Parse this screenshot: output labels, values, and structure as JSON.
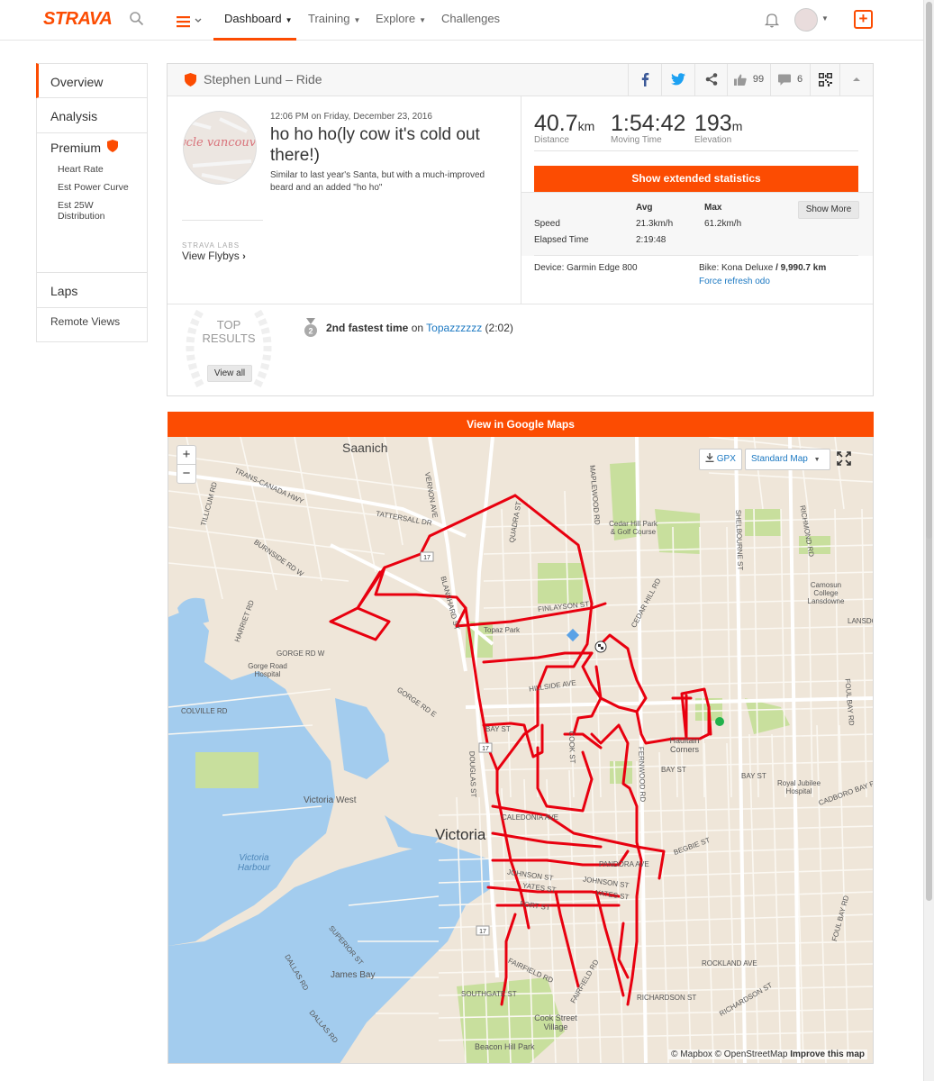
{
  "nav": {
    "logo": "STRAVA",
    "links": [
      "Dashboard",
      "Training",
      "Explore",
      "Challenges"
    ],
    "accent": "#fc4c02"
  },
  "sidebar": {
    "overview": "Overview",
    "analysis": "Analysis",
    "premium": "Premium",
    "premium_items": [
      "Heart Rate",
      "Est Power Curve",
      "Est 25W Distribution"
    ],
    "laps": "Laps",
    "remote_views": "Remote Views"
  },
  "activity": {
    "title": "Stephen Lund – Ride",
    "kudos": "99",
    "comments": "6",
    "datetime_time": "12:06 PM",
    "datetime_on": " on ",
    "datetime_date": "Friday, December 23, 2016",
    "name": "ho ho ho(ly cow it's cold out there!)",
    "description": "Similar to last year's Santa, but with a much-improved beard and an added \"ho ho\"",
    "labs": "STRAVA LABS",
    "view_flybys": "View Flybys",
    "avatar_text": "cycle vancouver"
  },
  "stats": {
    "distance": {
      "value": "40.7",
      "unit": "km",
      "label": "Distance"
    },
    "moving_time": {
      "value": "1:54:42",
      "label": "Moving Time"
    },
    "elevation": {
      "value": "193",
      "unit": "m",
      "label": "Elevation"
    },
    "extended_button": "Show extended statistics",
    "table": {
      "col_avg": "Avg",
      "col_max": "Max",
      "speed_label": "Speed",
      "speed_avg": "21.3km/h",
      "speed_max": "61.2km/h",
      "elapsed_label": "Elapsed Time",
      "elapsed_value": "2:19:48",
      "show_more": "Show More"
    },
    "device": "Device: Garmin Edge 800",
    "bike_prefix": "Bike: Kona Deluxe ",
    "bike_odo": "/ 9,990.7 km",
    "force_refresh": "Force refresh odo"
  },
  "top_results": {
    "heading_1": "TOP",
    "heading_2": "RESULTS",
    "view_all": "View all",
    "medal_number": "2",
    "rank_text": "2nd fastest time",
    "on": " on ",
    "segment": "Topazzzzzz",
    "time": " (2:02)"
  },
  "map": {
    "google_maps_button": "View in Google Maps",
    "zoom_in": "+",
    "zoom_out": "−",
    "gpx": "GPX",
    "map_type": "Standard Map",
    "attribution_mapbox": "© Mapbox © OpenStreetMap ",
    "attribution_improve": "Improve this map",
    "route_color": "#e8000f",
    "start_color": "#22b14c",
    "places": [
      "Saanich",
      "Victoria",
      "Victoria West",
      "Victoria Harbour",
      "James Bay",
      "Beacon Hill Park",
      "Cook Street Village",
      "Haultain Corners",
      "Topaz Park",
      "Cedar Hill Park & Golf Course",
      "Camosun College Lansdowne",
      "Royal Jubilee Hospital",
      "Gorge Road Hospital"
    ],
    "streets": [
      "TRANS-CANADA HWY",
      "TATTERSALL DR",
      "HILLSIDE AVE",
      "BAY ST",
      "CALEDONIA AVE",
      "PANDORA AVE",
      "JOHNSON ST",
      "YATES ST",
      "FORT ST",
      "FAIRFIELD RD",
      "SOUTHGATE ST",
      "RICHARDSON ST",
      "ROCKLAND AVE",
      "DOUGLAS ST",
      "QUADRA ST",
      "COOK ST",
      "FERNWOOD RD",
      "SHELBOURNE ST",
      "RICHMOND RD",
      "FOUL BAY RD",
      "CEDAR HILL RD",
      "BLANSHARD ST",
      "GORGE RD E",
      "BURNSIDE RD W",
      "COLVILLE RD",
      "SUPERIOR ST",
      "DALLAS RD",
      "FINLAYSON ST",
      "MAPLEWOOD RD",
      "VERNON AVE",
      "TILLICUM RD",
      "HARRIET RD",
      "GORGE RD W",
      "CADBORO BAY RD",
      "BEGBIE ST",
      "LANSDOWNE"
    ]
  }
}
